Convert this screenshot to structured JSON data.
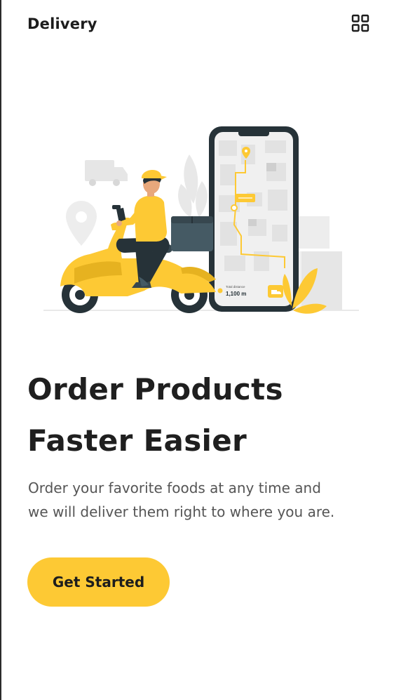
{
  "header": {
    "brand": "Delivery",
    "menu_icon": "grid-icon"
  },
  "illustration": {
    "subject": "scooter-delivery-illustration",
    "distance_label": "Total distance",
    "distance_value": "1,100 m"
  },
  "hero": {
    "headline_line1": "Order Products",
    "headline_line2": "Faster Easier",
    "subtitle_line1": "Order your favorite foods at any time and",
    "subtitle_line2": "we will deliver them right to where you are."
  },
  "cta": {
    "label": "Get Started"
  },
  "colors": {
    "accent": "#fdc934",
    "text_dark": "#1f1f1f",
    "text_muted": "#555555",
    "phone_frame": "#263238",
    "box_dark": "#455a64"
  }
}
